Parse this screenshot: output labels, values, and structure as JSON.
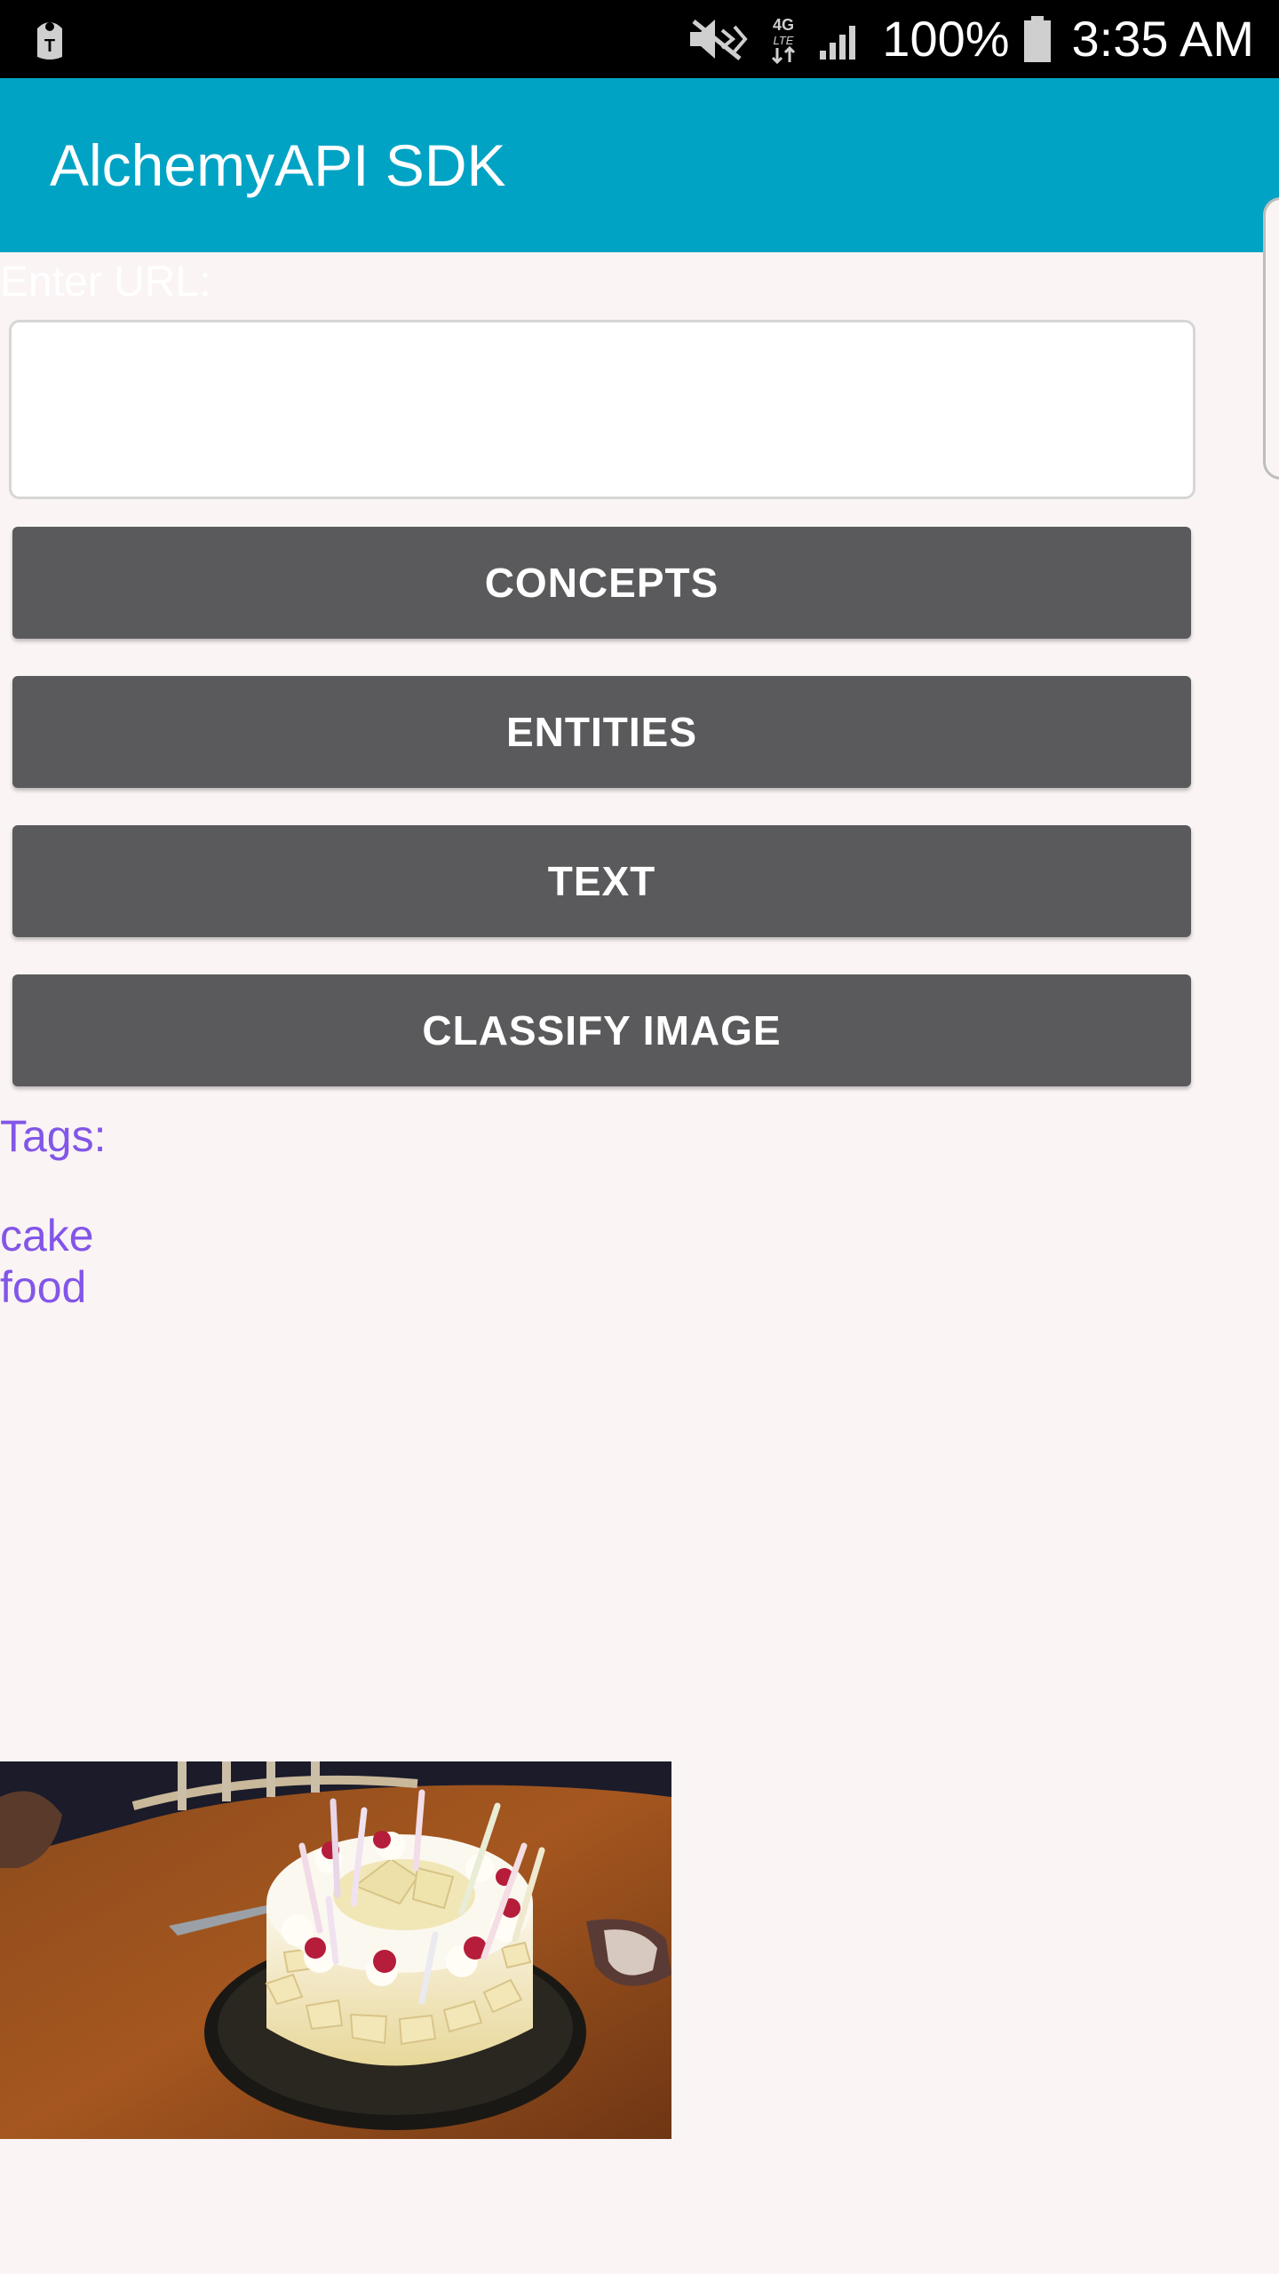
{
  "status_bar": {
    "battery_percent": "100%",
    "time": "3:35 AM",
    "icons": [
      "carrier-logo-icon",
      "mute-icon",
      "4g-lte-icon",
      "signal-icon",
      "battery-icon"
    ]
  },
  "app_bar": {
    "title": "AlchemyAPI SDK",
    "background_color": "#00a3c4"
  },
  "url_form": {
    "label": "Enter URL:",
    "value": "",
    "placeholder": ""
  },
  "buttons": {
    "concepts": "CONCEPTS",
    "entities": "ENTITIES",
    "text": "TEXT",
    "classify_image": "CLASSIFY IMAGE",
    "color": "#5a5a5c"
  },
  "results": {
    "heading": "Tags:",
    "tags": [
      "cake",
      "food"
    ],
    "color": "#8256e8"
  },
  "image": {
    "subject": "cake-photo"
  }
}
